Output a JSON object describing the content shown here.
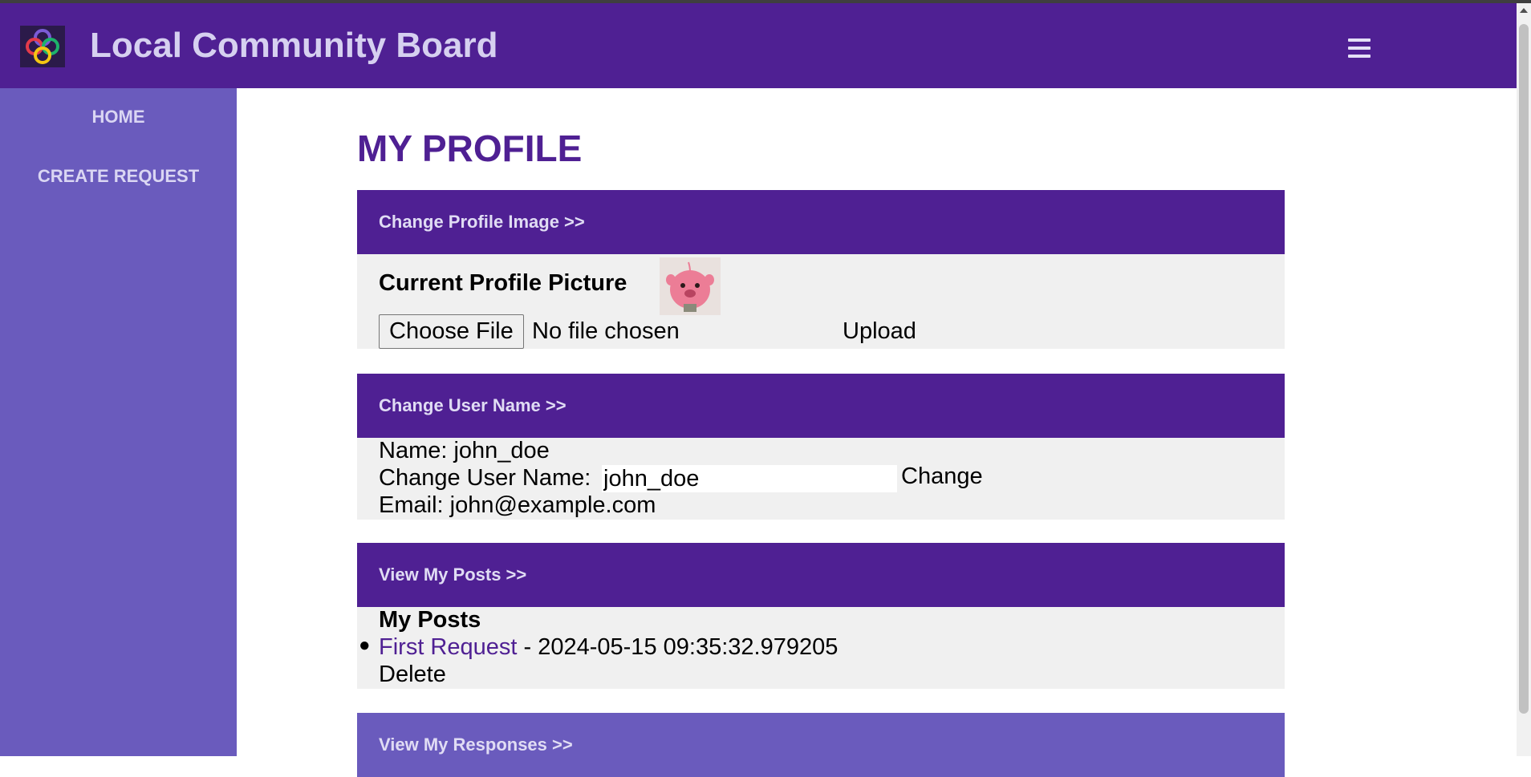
{
  "header": {
    "app_title": "Local Community Board"
  },
  "sidebar": {
    "items": [
      {
        "label": "HOME"
      },
      {
        "label": "CREATE REQUEST"
      }
    ]
  },
  "main": {
    "page_title": "MY PROFILE",
    "profile_image": {
      "header": "Change Profile Image >>",
      "current_label": "Current Profile Picture",
      "choose_file_label": "Choose File",
      "file_status": "No file chosen",
      "upload_label": "Upload"
    },
    "user_name": {
      "header": "Change User Name >>",
      "name_line": "Name: john_doe",
      "change_label_prefix": "Change User Name:",
      "input_value": "john_doe",
      "change_button": "Change",
      "email_line": "Email: john@example.com"
    },
    "posts": {
      "header": "View My Posts >>",
      "heading": "My Posts",
      "items": [
        {
          "title": "First Request",
          "timestamp": " - 2024-05-15 09:35:32.979205",
          "delete_label": "Delete"
        }
      ]
    },
    "responses": {
      "header": "View My Responses >>"
    }
  },
  "colors": {
    "header_bg": "#4f2093",
    "sidebar_bg": "#6a5bbd",
    "panel_body_bg": "#f0f0f0",
    "accent_text": "#4f2093"
  },
  "icons": [
    "app-logo-icon",
    "hamburger-menu-icon"
  ]
}
